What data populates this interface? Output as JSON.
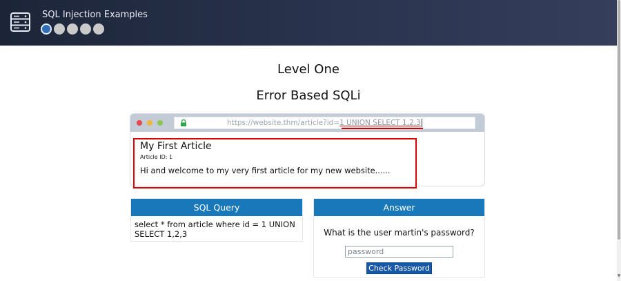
{
  "app": {
    "title": "SQL Injection Examples",
    "progress_steps": 5,
    "current_step": 1
  },
  "page": {
    "level_title": "Level One",
    "level_subtitle": "Error Based SQLi"
  },
  "browser": {
    "url_base": "https://website.thm/article?id=",
    "url_injection": "1 UNION SELECT 1,2,3",
    "article": {
      "title": "My First Article",
      "id_label": "Article ID: 1",
      "body": "Hi and welcome to my very first article for my new website......"
    }
  },
  "sql_panel": {
    "header": "SQL Query",
    "query": "select * from article where id = 1 UNION SELECT 1,2,3"
  },
  "answer_panel": {
    "header": "Answer",
    "question": "What is the user martin's password?",
    "input_placeholder": "password",
    "button_label": "Check Password"
  },
  "colors": {
    "header_bg": "#2b3550",
    "accent_blue": "#1878b9",
    "button_blue": "#1759a6",
    "highlight_red": "#e10000"
  }
}
